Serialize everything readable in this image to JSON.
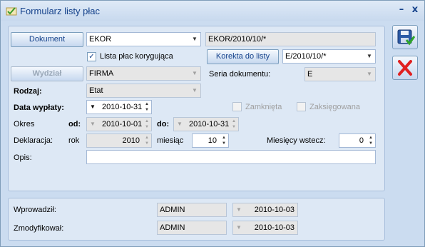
{
  "window": {
    "title": "Formularz listy płac",
    "minimize": "–",
    "close": "x"
  },
  "main": {
    "dokument_button": "Dokument",
    "dokument_value": "EKOR",
    "dokument_number": "EKOR/2010/10/*",
    "korygujaca_label": "Lista płac korygująca",
    "korekta_button": "Korekta do listy",
    "korekta_value": "E/2010/10/*",
    "wydzial_button": "Wydział",
    "wydzial_value": "FIRMA",
    "seria_label": "Seria dokumentu:",
    "seria_value": "E",
    "rodzaj_label": "Rodzaj:",
    "rodzaj_value": "Etat",
    "data_wyplaty_label": "Data wypłaty:",
    "data_wyplaty_value": "2010-10-31",
    "zamknieta_label": "Zamknięta",
    "zaksiegowana_label": "Zaksięgowana",
    "okres_label": "Okres",
    "od_label": "od:",
    "od_value": "2010-10-01",
    "do_label": "do:",
    "do_value": "2010-10-31",
    "deklaracja_label": "Deklaracja:",
    "rok_label": "rok",
    "rok_value": "2010",
    "miesiac_label": "miesiąc",
    "miesiac_value": "10",
    "miesiecy_label": "Miesięcy wstecz:",
    "miesiecy_value": "0",
    "opis_label": "Opis:",
    "opis_value": ""
  },
  "footer": {
    "wprowadzil_label": "Wprowadził:",
    "wprowadzil_user": "ADMIN",
    "wprowadzil_date": "2010-10-03",
    "zmodyfikowal_label": "Zmodyfikował:",
    "zmodyfikowal_user": "ADMIN",
    "zmodyfikowal_date": "2010-10-03"
  },
  "icons": {
    "save": "save-disk-icon",
    "cancel": "red-x-icon",
    "app": "payroll-check-icon"
  },
  "colors": {
    "title_text": "#15428b",
    "window_bg": "#cbdcf0",
    "panel_bg": "#dde8f5",
    "cancel_red": "#e02020"
  }
}
